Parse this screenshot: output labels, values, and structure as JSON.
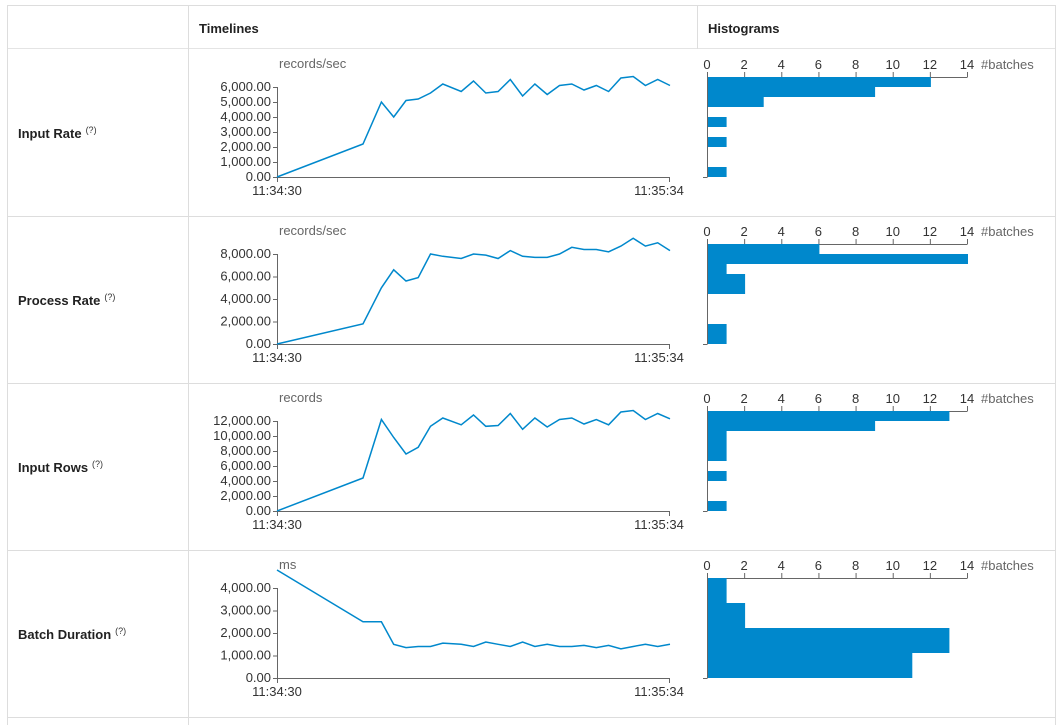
{
  "table": {
    "header_timelines": "Timelines",
    "header_histograms": "Histograms",
    "help_icon_text": "(?)"
  },
  "colors": {
    "series": "#0088cc",
    "axis": "#666666",
    "grid_border": "#dddddd",
    "text": "#333333"
  },
  "chart_data": [
    {
      "type": "line",
      "metric": "Input Rate",
      "ylabel": "records/sec",
      "ylim": [
        0,
        6000
      ],
      "yticks": [
        "0.00",
        "1,000.00",
        "2,000.00",
        "3,000.00",
        "4,000.00",
        "5,000.00",
        "6,000.00"
      ],
      "x_range": [
        "11:34:30",
        "11:35:34"
      ],
      "x": [
        "11:34:30",
        "11:34:44",
        "11:34:47",
        "11:34:49",
        "11:34:51",
        "11:34:53",
        "11:34:55",
        "11:34:57",
        "11:35:00",
        "11:35:02",
        "11:35:04",
        "11:35:06",
        "11:35:08",
        "11:35:10",
        "11:35:12",
        "11:35:14",
        "11:35:16",
        "11:35:18",
        "11:35:20",
        "11:35:22",
        "11:35:24",
        "11:35:26",
        "11:35:28",
        "11:35:30",
        "11:35:32",
        "11:35:34"
      ],
      "values": [
        0,
        2200,
        5000,
        4000,
        5100,
        5200,
        5600,
        6200,
        5700,
        6400,
        5600,
        5700,
        6500,
        5400,
        6200,
        5500,
        6100,
        6200,
        5800,
        6100,
        5700,
        6600,
        6700,
        6100,
        6500,
        6100
      ]
    },
    {
      "type": "bar",
      "orientation": "horizontal",
      "metric": "Input Rate histogram",
      "xlabel": "#batches",
      "xticks": [
        "0",
        "2",
        "4",
        "6",
        "8",
        "10",
        "12",
        "14"
      ],
      "xlim": [
        0,
        14
      ],
      "bin_range": [
        0,
        7000
      ],
      "bins": 10,
      "values": [
        1,
        0,
        0,
        1,
        0,
        1,
        0,
        3,
        9,
        12
      ]
    },
    {
      "type": "line",
      "metric": "Process Rate",
      "ylabel": "records/sec",
      "ylim": [
        0,
        8000
      ],
      "yticks": [
        "0.00",
        "2,000.00",
        "4,000.00",
        "6,000.00",
        "8,000.00"
      ],
      "x_range": [
        "11:34:30",
        "11:35:34"
      ],
      "x": [
        "11:34:30",
        "11:34:44",
        "11:34:47",
        "11:34:49",
        "11:34:51",
        "11:34:53",
        "11:34:55",
        "11:34:57",
        "11:35:00",
        "11:35:02",
        "11:35:04",
        "11:35:06",
        "11:35:08",
        "11:35:10",
        "11:35:12",
        "11:35:14",
        "11:35:16",
        "11:35:18",
        "11:35:20",
        "11:35:22",
        "11:35:24",
        "11:35:26",
        "11:35:28",
        "11:35:30",
        "11:35:32",
        "11:35:34"
      ],
      "values": [
        0,
        1800,
        5000,
        6600,
        5600,
        5900,
        8000,
        7800,
        7600,
        8000,
        7900,
        7600,
        8300,
        7800,
        7700,
        7700,
        8000,
        8600,
        8400,
        8400,
        8200,
        8700,
        9400,
        8700,
        9000,
        8300
      ]
    },
    {
      "type": "bar",
      "orientation": "horizontal",
      "metric": "Process Rate histogram",
      "xlabel": "#batches",
      "xticks": [
        "0",
        "2",
        "4",
        "6",
        "8",
        "10",
        "12",
        "14"
      ],
      "xlim": [
        0,
        14
      ],
      "bin_range": [
        0,
        10000
      ],
      "bins": 10,
      "values": [
        1,
        1,
        0,
        0,
        0,
        2,
        2,
        1,
        14,
        6
      ]
    },
    {
      "type": "line",
      "metric": "Input Rows",
      "ylabel": "records",
      "ylim": [
        0,
        12000
      ],
      "yticks": [
        "0.00",
        "2,000.00",
        "4,000.00",
        "6,000.00",
        "8,000.00",
        "10,000.00",
        "12,000.00"
      ],
      "x_range": [
        "11:34:30",
        "11:35:34"
      ],
      "x": [
        "11:34:30",
        "11:34:44",
        "11:34:47",
        "11:34:49",
        "11:34:51",
        "11:34:53",
        "11:34:55",
        "11:34:57",
        "11:35:00",
        "11:35:02",
        "11:35:04",
        "11:35:06",
        "11:35:08",
        "11:35:10",
        "11:35:12",
        "11:35:14",
        "11:35:16",
        "11:35:18",
        "11:35:20",
        "11:35:22",
        "11:35:24",
        "11:35:26",
        "11:35:28",
        "11:35:30",
        "11:35:32",
        "11:35:34"
      ],
      "values": [
        0,
        4400,
        12200,
        9800,
        7600,
        8500,
        11300,
        12400,
        11500,
        12800,
        11300,
        11400,
        13000,
        10900,
        12400,
        11200,
        12200,
        12400,
        11600,
        12200,
        11500,
        13200,
        13400,
        12200,
        13000,
        12300
      ]
    },
    {
      "type": "bar",
      "orientation": "horizontal",
      "metric": "Input Rows histogram",
      "xlabel": "#batches",
      "xticks": [
        "0",
        "2",
        "4",
        "6",
        "8",
        "10",
        "12",
        "14"
      ],
      "xlim": [
        0,
        14
      ],
      "bin_range": [
        0,
        14000
      ],
      "bins": 10,
      "values": [
        1,
        0,
        0,
        1,
        0,
        1,
        1,
        1,
        9,
        13
      ]
    },
    {
      "type": "line",
      "metric": "Batch Duration",
      "ylabel": "ms",
      "ylim": [
        0,
        4000
      ],
      "yticks": [
        "0.00",
        "1,000.00",
        "2,000.00",
        "3,000.00",
        "4,000.00"
      ],
      "x_range": [
        "11:34:30",
        "11:35:34"
      ],
      "x": [
        "11:34:30",
        "11:34:44",
        "11:34:47",
        "11:34:49",
        "11:34:51",
        "11:34:53",
        "11:34:55",
        "11:34:57",
        "11:35:00",
        "11:35:02",
        "11:35:04",
        "11:35:06",
        "11:35:08",
        "11:35:10",
        "11:35:12",
        "11:35:14",
        "11:35:16",
        "11:35:18",
        "11:35:20",
        "11:35:22",
        "11:35:24",
        "11:35:26",
        "11:35:28",
        "11:35:30",
        "11:35:32",
        "11:35:34"
      ],
      "values": [
        4800,
        2500,
        2500,
        1500,
        1350,
        1400,
        1400,
        1550,
        1500,
        1400,
        1600,
        1500,
        1400,
        1600,
        1400,
        1500,
        1400,
        1400,
        1450,
        1350,
        1450,
        1300,
        1400,
        1500,
        1400,
        1500
      ]
    },
    {
      "type": "bar",
      "orientation": "horizontal",
      "metric": "Batch Duration histogram",
      "xlabel": "#batches",
      "xticks": [
        "0",
        "2",
        "4",
        "6",
        "8",
        "10",
        "12",
        "14"
      ],
      "xlim": [
        0,
        14
      ],
      "bin_range": [
        1000,
        5000
      ],
      "bins": 4,
      "values": [
        11,
        13,
        2,
        1
      ]
    }
  ],
  "rows": [
    {
      "label": "Input Rate"
    },
    {
      "label": "Process Rate"
    },
    {
      "label": "Input Rows"
    },
    {
      "label": "Batch Duration"
    }
  ]
}
